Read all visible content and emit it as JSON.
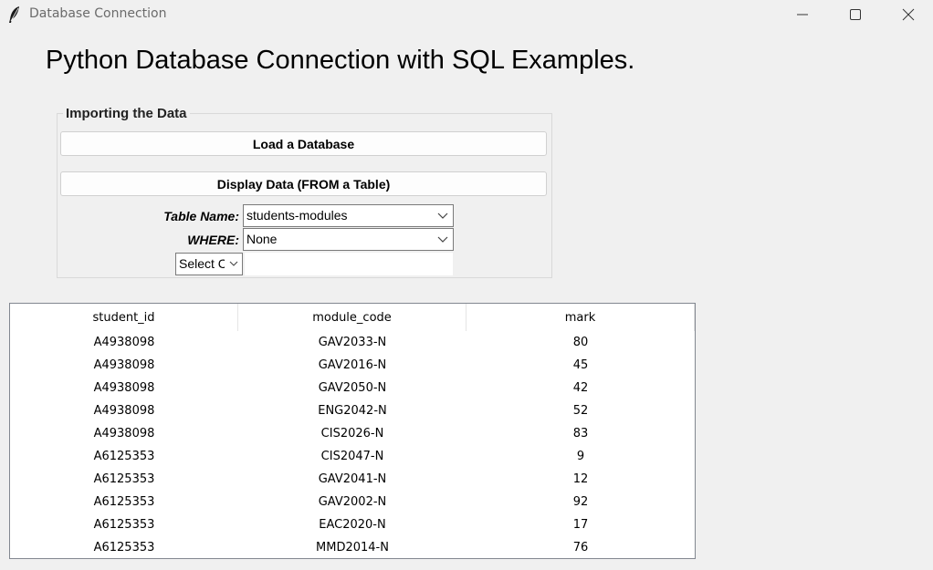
{
  "window": {
    "title": "Database Connection"
  },
  "main": {
    "heading": "Python Database Connection with SQL Examples."
  },
  "import_group": {
    "legend": "Importing the Data",
    "load_button": "Load a Database",
    "display_button": "Display Data (FROM a Table)",
    "table_name_label": "Table Name:",
    "table_name_value": "students-modules",
    "where_label": "WHERE:",
    "where_value": "None",
    "column_select_value": "Select Column",
    "where_entry_value": ""
  },
  "table": {
    "columns": [
      "student_id",
      "module_code",
      "mark"
    ],
    "rows": [
      [
        "A4938098",
        "GAV2033-N",
        "80"
      ],
      [
        "A4938098",
        "GAV2016-N",
        "45"
      ],
      [
        "A4938098",
        "GAV2050-N",
        "42"
      ],
      [
        "A4938098",
        "ENG2042-N",
        "52"
      ],
      [
        "A4938098",
        "CIS2026-N",
        "83"
      ],
      [
        "A6125353",
        "CIS2047-N",
        "9"
      ],
      [
        "A6125353",
        "GAV2041-N",
        "12"
      ],
      [
        "A6125353",
        "GAV2002-N",
        "92"
      ],
      [
        "A6125353",
        "EAC2020-N",
        "17"
      ],
      [
        "A6125353",
        "MMD2014-N",
        "76"
      ]
    ]
  },
  "icons": {
    "app": "feather-icon",
    "minimize": "minimize-icon",
    "maximize": "maximize-icon",
    "close": "close-icon",
    "dropdown": "chevron-down-icon"
  }
}
